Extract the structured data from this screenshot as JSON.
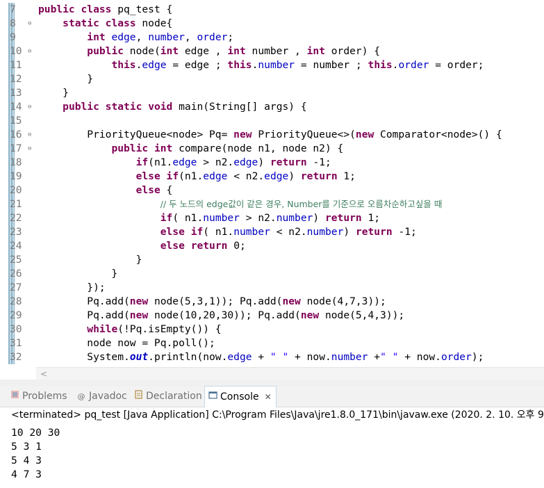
{
  "editor": {
    "lines": [
      {
        "n": "7",
        "fold": ""
      },
      {
        "n": "8",
        "fold": "⊖"
      },
      {
        "n": "9",
        "fold": ""
      },
      {
        "n": "10",
        "fold": "⊖"
      },
      {
        "n": "11",
        "fold": ""
      },
      {
        "n": "12",
        "fold": ""
      },
      {
        "n": "13",
        "fold": ""
      },
      {
        "n": "14",
        "fold": "⊖"
      },
      {
        "n": "15",
        "fold": ""
      },
      {
        "n": "16",
        "fold": "⊖"
      },
      {
        "n": "17",
        "fold": "⊖"
      },
      {
        "n": "18",
        "fold": ""
      },
      {
        "n": "19",
        "fold": ""
      },
      {
        "n": "20",
        "fold": ""
      },
      {
        "n": "21",
        "fold": ""
      },
      {
        "n": "22",
        "fold": ""
      },
      {
        "n": "23",
        "fold": ""
      },
      {
        "n": "24",
        "fold": ""
      },
      {
        "n": "25",
        "fold": ""
      },
      {
        "n": "26",
        "fold": ""
      },
      {
        "n": "27",
        "fold": ""
      },
      {
        "n": "28",
        "fold": ""
      },
      {
        "n": "29",
        "fold": ""
      },
      {
        "n": "30",
        "fold": ""
      },
      {
        "n": "31",
        "fold": ""
      },
      {
        "n": "32",
        "fold": ""
      }
    ],
    "code": [
      [
        [
          "kw",
          "public"
        ],
        [
          "t",
          " "
        ],
        [
          "kw",
          "class"
        ],
        [
          "t",
          " pq_test {"
        ]
      ],
      [
        [
          "t",
          "    "
        ],
        [
          "kw",
          "static"
        ],
        [
          "t",
          " "
        ],
        [
          "kw",
          "class"
        ],
        [
          "t",
          " node{"
        ]
      ],
      [
        [
          "t",
          "        "
        ],
        [
          "kw",
          "int"
        ],
        [
          "t",
          " "
        ],
        [
          "fd",
          "edge"
        ],
        [
          "t",
          ", "
        ],
        [
          "fd",
          "number"
        ],
        [
          "t",
          ", "
        ],
        [
          "fd",
          "order"
        ],
        [
          "t",
          ";"
        ]
      ],
      [
        [
          "t",
          "        "
        ],
        [
          "kw",
          "public"
        ],
        [
          "t",
          " node("
        ],
        [
          "kw",
          "int"
        ],
        [
          "t",
          " edge , "
        ],
        [
          "kw",
          "int"
        ],
        [
          "t",
          " number , "
        ],
        [
          "kw",
          "int"
        ],
        [
          "t",
          " order) {"
        ]
      ],
      [
        [
          "t",
          "            "
        ],
        [
          "kw",
          "this"
        ],
        [
          "t",
          "."
        ],
        [
          "fd",
          "edge"
        ],
        [
          "t",
          " = edge ; "
        ],
        [
          "kw",
          "this"
        ],
        [
          "t",
          "."
        ],
        [
          "fd",
          "number"
        ],
        [
          "t",
          " = number ; "
        ],
        [
          "kw",
          "this"
        ],
        [
          "t",
          "."
        ],
        [
          "fd",
          "order"
        ],
        [
          "t",
          " = order;"
        ]
      ],
      [
        [
          "t",
          "        }"
        ]
      ],
      [
        [
          "t",
          "    }"
        ]
      ],
      [
        [
          "t",
          "    "
        ],
        [
          "kw",
          "public"
        ],
        [
          "t",
          " "
        ],
        [
          "kw",
          "static"
        ],
        [
          "t",
          " "
        ],
        [
          "kw",
          "void"
        ],
        [
          "t",
          " main(String[] args) {"
        ]
      ],
      [
        [
          "t",
          ""
        ]
      ],
      [
        [
          "t",
          "        PriorityQueue<node> Pq= "
        ],
        [
          "kw",
          "new"
        ],
        [
          "t",
          " PriorityQueue<>("
        ],
        [
          "kw",
          "new"
        ],
        [
          "t",
          " Comparator<node>() {"
        ]
      ],
      [
        [
          "t",
          "            "
        ],
        [
          "kw",
          "public"
        ],
        [
          "t",
          " "
        ],
        [
          "kw",
          "int"
        ],
        [
          "t",
          " compare(node n1, node n2) {"
        ]
      ],
      [
        [
          "t",
          "                "
        ],
        [
          "kw",
          "if"
        ],
        [
          "t",
          "(n1."
        ],
        [
          "fd",
          "edge"
        ],
        [
          "t",
          " > n2."
        ],
        [
          "fd",
          "edge"
        ],
        [
          "t",
          ") "
        ],
        [
          "kw",
          "return"
        ],
        [
          "t",
          " -1;"
        ]
      ],
      [
        [
          "t",
          "                "
        ],
        [
          "kw",
          "else"
        ],
        [
          "t",
          " "
        ],
        [
          "kw",
          "if"
        ],
        [
          "t",
          "(n1."
        ],
        [
          "fd",
          "edge"
        ],
        [
          "t",
          " < n2."
        ],
        [
          "fd",
          "edge"
        ],
        [
          "t",
          ") "
        ],
        [
          "kw",
          "return"
        ],
        [
          "t",
          " 1;"
        ]
      ],
      [
        [
          "t",
          "                "
        ],
        [
          "kw",
          "else"
        ],
        [
          "t",
          " {"
        ]
      ],
      [
        [
          "t",
          "                    "
        ],
        [
          "cm",
          "// 두 노드의 edge값이 같은 경우, Number를 기준으로 오름차순하고싶을 때"
        ]
      ],
      [
        [
          "t",
          "                    "
        ],
        [
          "kw",
          "if"
        ],
        [
          "t",
          "( n1."
        ],
        [
          "fd",
          "number"
        ],
        [
          "t",
          " > n2."
        ],
        [
          "fd",
          "number"
        ],
        [
          "t",
          ") "
        ],
        [
          "kw",
          "return"
        ],
        [
          "t",
          " 1;"
        ]
      ],
      [
        [
          "t",
          "                    "
        ],
        [
          "kw",
          "else"
        ],
        [
          "t",
          " "
        ],
        [
          "kw",
          "if"
        ],
        [
          "t",
          "( n1."
        ],
        [
          "fd",
          "number"
        ],
        [
          "t",
          " < n2."
        ],
        [
          "fd",
          "number"
        ],
        [
          "t",
          ") "
        ],
        [
          "kw",
          "return"
        ],
        [
          "t",
          " -1;"
        ]
      ],
      [
        [
          "t",
          "                    "
        ],
        [
          "kw",
          "else"
        ],
        [
          "t",
          " "
        ],
        [
          "kw",
          "return"
        ],
        [
          "t",
          " 0;"
        ]
      ],
      [
        [
          "t",
          "                }"
        ]
      ],
      [
        [
          "t",
          "            }"
        ]
      ],
      [
        [
          "t",
          "        });"
        ]
      ],
      [
        [
          "t",
          "        Pq.add("
        ],
        [
          "kw",
          "new"
        ],
        [
          "t",
          " node(5,3,1)); Pq.add("
        ],
        [
          "kw",
          "new"
        ],
        [
          "t",
          " node(4,7,3));"
        ]
      ],
      [
        [
          "t",
          "        Pq.add("
        ],
        [
          "kw",
          "new"
        ],
        [
          "t",
          " node(10,20,30)); Pq.add("
        ],
        [
          "kw",
          "new"
        ],
        [
          "t",
          " node(5,4,3));"
        ]
      ],
      [
        [
          "t",
          "        "
        ],
        [
          "kw",
          "while"
        ],
        [
          "t",
          "(!Pq.isEmpty()) {"
        ]
      ],
      [
        [
          "t",
          "        node now = Pq.poll();"
        ]
      ],
      [
        [
          "t",
          "        System."
        ],
        [
          "sf",
          "out"
        ],
        [
          "t",
          ".println(now."
        ],
        [
          "fd",
          "edge"
        ],
        [
          "t",
          " + "
        ],
        [
          "st",
          "\" \""
        ],
        [
          "t",
          " + now."
        ],
        [
          "fd",
          "number"
        ],
        [
          "t",
          " +"
        ],
        [
          "st",
          "\" \""
        ],
        [
          "t",
          " + now."
        ],
        [
          "fd",
          "order"
        ],
        [
          "t",
          ");"
        ]
      ]
    ]
  },
  "tabs": {
    "problems": {
      "label": "Problems",
      "icon": "problems-icon"
    },
    "javadoc": {
      "label": "Javadoc",
      "icon": "at-icon",
      "glyph": "@"
    },
    "declaration": {
      "label": "Declaration",
      "icon": "declaration-icon"
    },
    "console": {
      "label": "Console",
      "icon": "console-icon",
      "close": "✕"
    }
  },
  "console": {
    "status": "<terminated> pq_test [Java Application] C:\\Program Files\\Java\\jre1.8.0_171\\bin\\javaw.exe (2020. 2. 10. 오후 9:",
    "output": [
      "10 20 30",
      "5 3 1",
      "5 4 3",
      "4 7 3"
    ]
  },
  "scrollbar": {
    "left_arrow": "<"
  }
}
